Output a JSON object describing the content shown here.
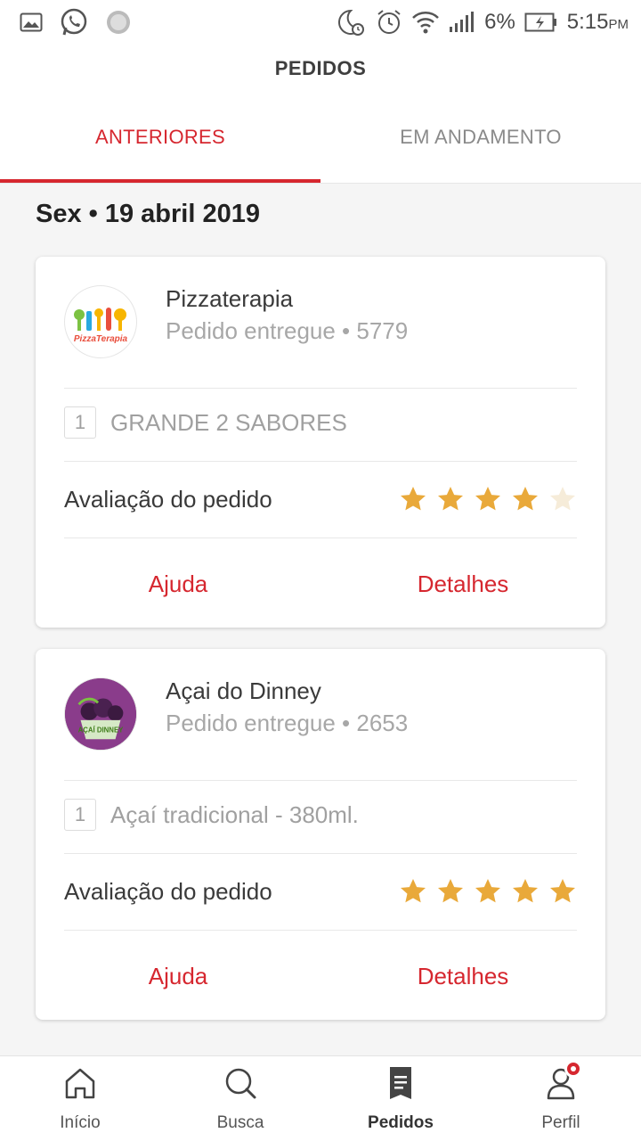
{
  "status_bar": {
    "battery": "6%",
    "time": "5:15",
    "ampm": "PM"
  },
  "header": {
    "title": "PEDIDOS",
    "tabs": [
      {
        "label": "ANTERIORES",
        "active": true
      },
      {
        "label": "EM ANDAMENTO",
        "active": false
      }
    ]
  },
  "date_heading": "Sex • 19 abril 2019",
  "orders": [
    {
      "restaurant": "Pizzaterapia",
      "status": "Pedido entregue • 5779",
      "logo_text": "PizzaTerapia",
      "quantity": "1",
      "item": "GRANDE  2 SABORES",
      "rating_label": "Avaliação do pedido",
      "rating": 4,
      "rating_max": 5,
      "help_label": "Ajuda",
      "details_label": "Detalhes"
    },
    {
      "restaurant": "Açai do Dinney",
      "status": "Pedido entregue • 2653",
      "logo_text": "AÇAÍ DINNEY",
      "quantity": "1",
      "item": "Açaí tradicional - 380ml.",
      "rating_label": "Avaliação do pedido",
      "rating": 5,
      "rating_max": 5,
      "help_label": "Ajuda",
      "details_label": "Detalhes"
    }
  ],
  "bottom_nav": [
    {
      "label": "Início",
      "icon": "home-icon",
      "active": false
    },
    {
      "label": "Busca",
      "icon": "search-icon",
      "active": false
    },
    {
      "label": "Pedidos",
      "icon": "orders-icon",
      "active": true
    },
    {
      "label": "Perfil",
      "icon": "profile-icon",
      "active": false,
      "badge": true
    }
  ],
  "colors": {
    "accent": "#d6272f",
    "star": "#e9a93a",
    "star_empty": "#f6ecd9"
  }
}
